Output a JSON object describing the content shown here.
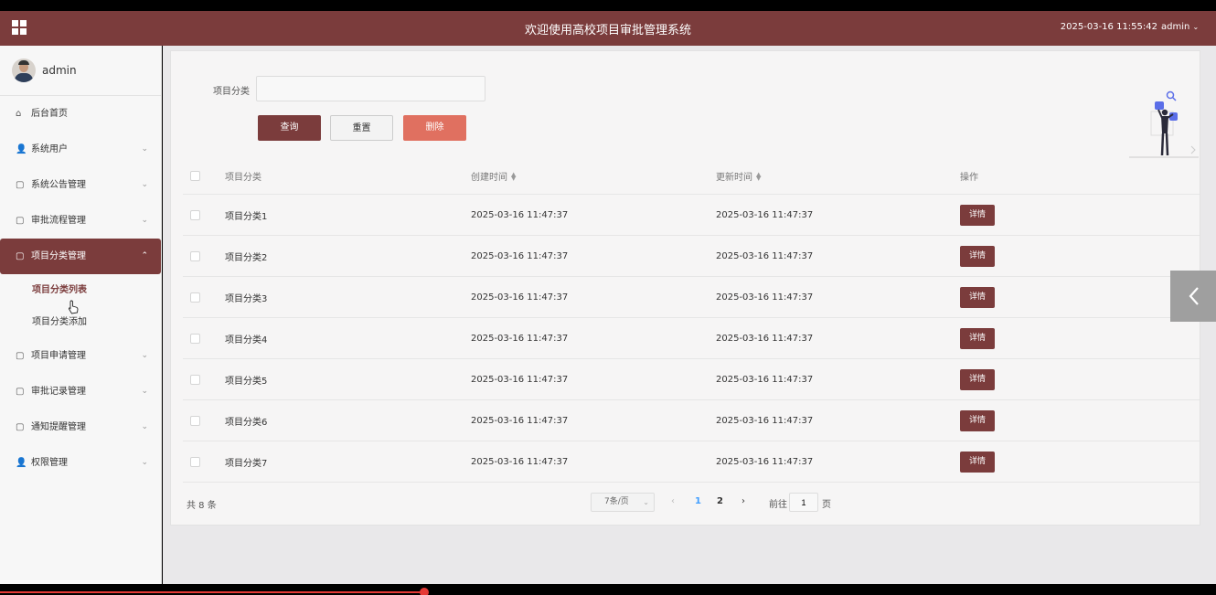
{
  "header": {
    "title": "欢迎使用高校项目审批管理系统",
    "datetime": "2025-03-16 11:55:42",
    "user": "admin",
    "caret": "⌄"
  },
  "sidebar": {
    "username": "admin",
    "items": [
      {
        "label": "后台首页",
        "icon": "⌂",
        "chev": ""
      },
      {
        "label": "系统用户",
        "icon": "👤",
        "chev": "⌄"
      },
      {
        "label": "系统公告管理",
        "icon": "▢",
        "chev": "⌄"
      },
      {
        "label": "审批流程管理",
        "icon": "▢",
        "chev": "⌄"
      },
      {
        "label": "项目分类管理",
        "icon": "▢",
        "chev": "⌃"
      },
      {
        "label": "项目申请管理",
        "icon": "▢",
        "chev": "⌄"
      },
      {
        "label": "审批记录管理",
        "icon": "▢",
        "chev": "⌄"
      },
      {
        "label": "通知提醒管理",
        "icon": "▢",
        "chev": "⌄"
      },
      {
        "label": "权限管理",
        "icon": "👤",
        "chev": "⌄"
      }
    ],
    "subitems": [
      "项目分类列表",
      "项目分类添加"
    ]
  },
  "filter": {
    "label": "项目分类",
    "value": "",
    "query": "查询",
    "reset": "重置",
    "delete": "删除"
  },
  "table": {
    "headers": {
      "category": "项目分类",
      "created": "创建时间",
      "updated": "更新时间",
      "op": "操作"
    },
    "rows": [
      {
        "category": "项目分类1",
        "created": "2025-03-16 11:47:37",
        "updated": "2025-03-16 11:47:37",
        "op": "详情"
      },
      {
        "category": "项目分类2",
        "created": "2025-03-16 11:47:37",
        "updated": "2025-03-16 11:47:37",
        "op": "详情"
      },
      {
        "category": "项目分类3",
        "created": "2025-03-16 11:47:37",
        "updated": "2025-03-16 11:47:37",
        "op": "详情"
      },
      {
        "category": "项目分类4",
        "created": "2025-03-16 11:47:37",
        "updated": "2025-03-16 11:47:37",
        "op": "详情"
      },
      {
        "category": "项目分类5",
        "created": "2025-03-16 11:47:37",
        "updated": "2025-03-16 11:47:37",
        "op": "详情"
      },
      {
        "category": "项目分类6",
        "created": "2025-03-16 11:47:37",
        "updated": "2025-03-16 11:47:37",
        "op": "详情"
      },
      {
        "category": "项目分类7",
        "created": "2025-03-16 11:47:37",
        "updated": "2025-03-16 11:47:37",
        "op": "详情"
      }
    ]
  },
  "pagination": {
    "total": "共 8 条",
    "pagesize": "7条/页",
    "prev": "‹",
    "pages": [
      "1",
      "2"
    ],
    "next": "›",
    "goto_label": "前往",
    "goto_value": "1",
    "suffix": "页"
  },
  "colors": {
    "brand": "#7b3c3c",
    "delete": "#e07060",
    "page_active": "#409eff"
  },
  "video_progress": 0.35
}
